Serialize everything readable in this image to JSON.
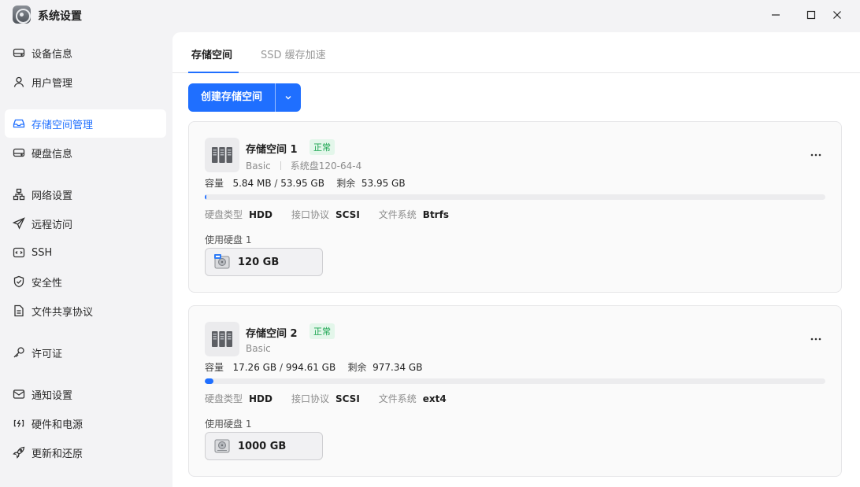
{
  "app": {
    "title": "系统设置"
  },
  "sidebar": {
    "items": [
      {
        "label": "设备信息",
        "icon": "device-icon"
      },
      {
        "label": "用户管理",
        "icon": "user-icon"
      },
      {
        "label": "存储空间管理",
        "icon": "storage-icon",
        "active": true
      },
      {
        "label": "硬盘信息",
        "icon": "disk-icon"
      },
      {
        "label": "网络设置",
        "icon": "network-icon"
      },
      {
        "label": "远程访问",
        "icon": "send-icon"
      },
      {
        "label": "SSH",
        "icon": "terminal-icon"
      },
      {
        "label": "安全性",
        "icon": "shield-icon"
      },
      {
        "label": "文件共享协议",
        "icon": "document-icon"
      },
      {
        "label": "许可证",
        "icon": "key-icon"
      },
      {
        "label": "通知设置",
        "icon": "mail-icon"
      },
      {
        "label": "硬件和电源",
        "icon": "power-icon"
      },
      {
        "label": "更新和还原",
        "icon": "rocket-icon"
      }
    ]
  },
  "tabs": {
    "storage": "存储空间",
    "ssd": "SSD 缓存加速"
  },
  "toolbar": {
    "create_label": "创建存储空间"
  },
  "labels": {
    "capacity": "容量",
    "remaining": "剩余",
    "disk_type": "硬盘类型",
    "interface": "接口协议",
    "filesystem": "文件系统",
    "disks_used": "使用硬盘 1"
  },
  "pools": [
    {
      "name": "存储空间 1",
      "status": "正常",
      "raid": "Basic",
      "system_disk": "系统盘120-64-4",
      "used": "5.84 MB",
      "total": "53.95 GB",
      "remaining": "53.95 GB",
      "usage_fraction": 0.0001,
      "disk_type": "HDD",
      "interface": "SCSI",
      "filesystem": "Btrfs",
      "disk_size": "120 GB"
    },
    {
      "name": "存储空间 2",
      "status": "正常",
      "raid": "Basic",
      "used": "17.26 GB",
      "total": "994.61 GB",
      "remaining": "977.34 GB",
      "usage_fraction": 0.0174,
      "disk_type": "HDD",
      "interface": "SCSI",
      "filesystem": "ext4",
      "disk_size": "1000 GB"
    }
  ],
  "colors": {
    "accent": "#1f6fff",
    "ok": "#19a44f",
    "ok_bg": "#e3f6ea"
  }
}
